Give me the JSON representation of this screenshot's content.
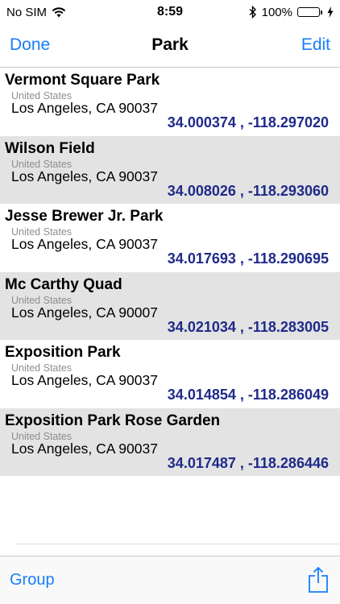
{
  "status_bar": {
    "carrier": "No SIM",
    "time": "8:59",
    "battery_percent": "100%",
    "battery_level": 1.0,
    "icons": [
      "wifi-icon",
      "bluetooth-icon",
      "battery-icon",
      "charging-icon"
    ]
  },
  "nav": {
    "left_label": "Done",
    "title": "Park",
    "right_label": "Edit"
  },
  "items": [
    {
      "name": "Vermont Square Park",
      "country": "United States",
      "city": "Los Angeles, CA 90037",
      "coords": "34.000374 , -118.297020"
    },
    {
      "name": "Wilson Field",
      "country": "United States",
      "city": "Los Angeles, CA 90037",
      "coords": "34.008026 , -118.293060"
    },
    {
      "name": "Jesse Brewer Jr. Park",
      "country": "United States",
      "city": "Los Angeles, CA 90037",
      "coords": "34.017693 , -118.290695"
    },
    {
      "name": "Mc Carthy Quad",
      "country": "United States",
      "city": "Los Angeles, CA 90007",
      "coords": "34.021034 , -118.283005"
    },
    {
      "name": "Exposition Park",
      "country": "United States",
      "city": "Los Angeles, CA 90037",
      "coords": "34.014854 , -118.286049"
    },
    {
      "name": "Exposition Park Rose Garden",
      "country": "United States",
      "city": "Los Angeles, CA 90037",
      "coords": "34.017487 , -118.286446"
    }
  ],
  "toolbar": {
    "left_label": "Group",
    "right_icon": "share-icon"
  },
  "colors": {
    "accent": "#157efb",
    "coords": "#1f2a8a",
    "row_alt": "#e3e3e3",
    "battery": "#4cd964"
  }
}
